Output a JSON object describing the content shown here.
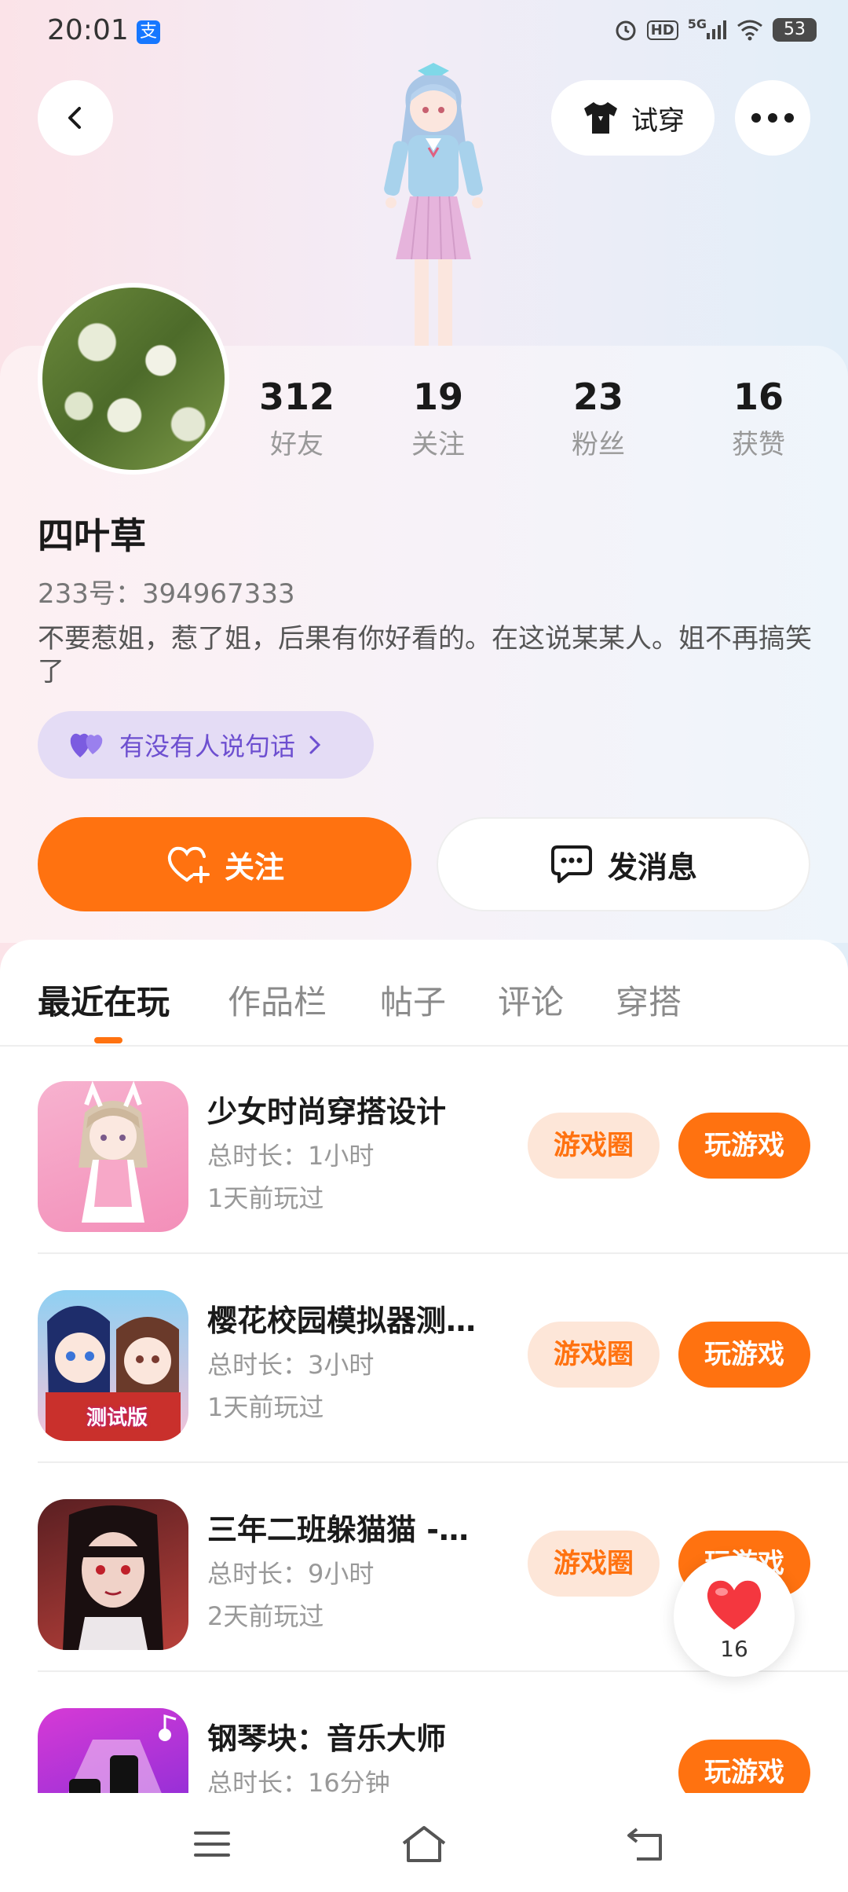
{
  "status_bar": {
    "time": "20:01",
    "app_badge": "支",
    "network": "5G",
    "hd": "HD",
    "battery": "53",
    "icons": [
      "alarm-icon",
      "hd-icon",
      "signal-icon",
      "wifi-icon",
      "battery-icon"
    ]
  },
  "header": {
    "back_icon": "back-chevron-icon",
    "try_on_label": "试穿",
    "more_icon": "more-dots-icon"
  },
  "profile": {
    "stats": [
      {
        "num": "312",
        "label": "好友"
      },
      {
        "num": "19",
        "label": "关注"
      },
      {
        "num": "23",
        "label": "粉丝"
      },
      {
        "num": "16",
        "label": "获赞"
      }
    ],
    "name": "四叶草",
    "uid": "233号：394967333",
    "bio": "不要惹姐，惹了姐，后果有你好看的。在这说某某人。姐不再搞笑了",
    "mood_label": "有没有人说句话"
  },
  "actions": {
    "follow_label": "关注",
    "message_label": "发消息"
  },
  "tabs": [
    {
      "label": "最近在玩",
      "active": true
    },
    {
      "label": "作品栏",
      "active": false
    },
    {
      "label": "帖子",
      "active": false
    },
    {
      "label": "评论",
      "active": false
    },
    {
      "label": "穿搭",
      "active": false
    }
  ],
  "games": [
    {
      "title": "少女时尚穿搭设计",
      "duration": "总时长：1小时",
      "last_played": "1天前玩过",
      "circle_label": "游戏圈",
      "play_label": "玩游戏"
    },
    {
      "title": "樱花校园模拟器测…",
      "duration": "总时长：3小时",
      "last_played": "1天前玩过",
      "circle_label": "游戏圈",
      "play_label": "玩游戏",
      "icon_badge": "测试版"
    },
    {
      "title": "三年二班躲猫猫 -…",
      "duration": "总时长：9小时",
      "last_played": "2天前玩过",
      "circle_label": "游戏圈",
      "play_label": "玩游戏"
    },
    {
      "title": "钢琴块：音乐大师",
      "duration": "总时长：16分钟",
      "last_played": "",
      "circle_label": "",
      "play_label": "玩游戏"
    }
  ],
  "like_float": {
    "count": "16"
  },
  "colors": {
    "accent": "#ff7210",
    "mood_bg": "#e4dcf5",
    "mood_text": "#6d4fd0"
  }
}
